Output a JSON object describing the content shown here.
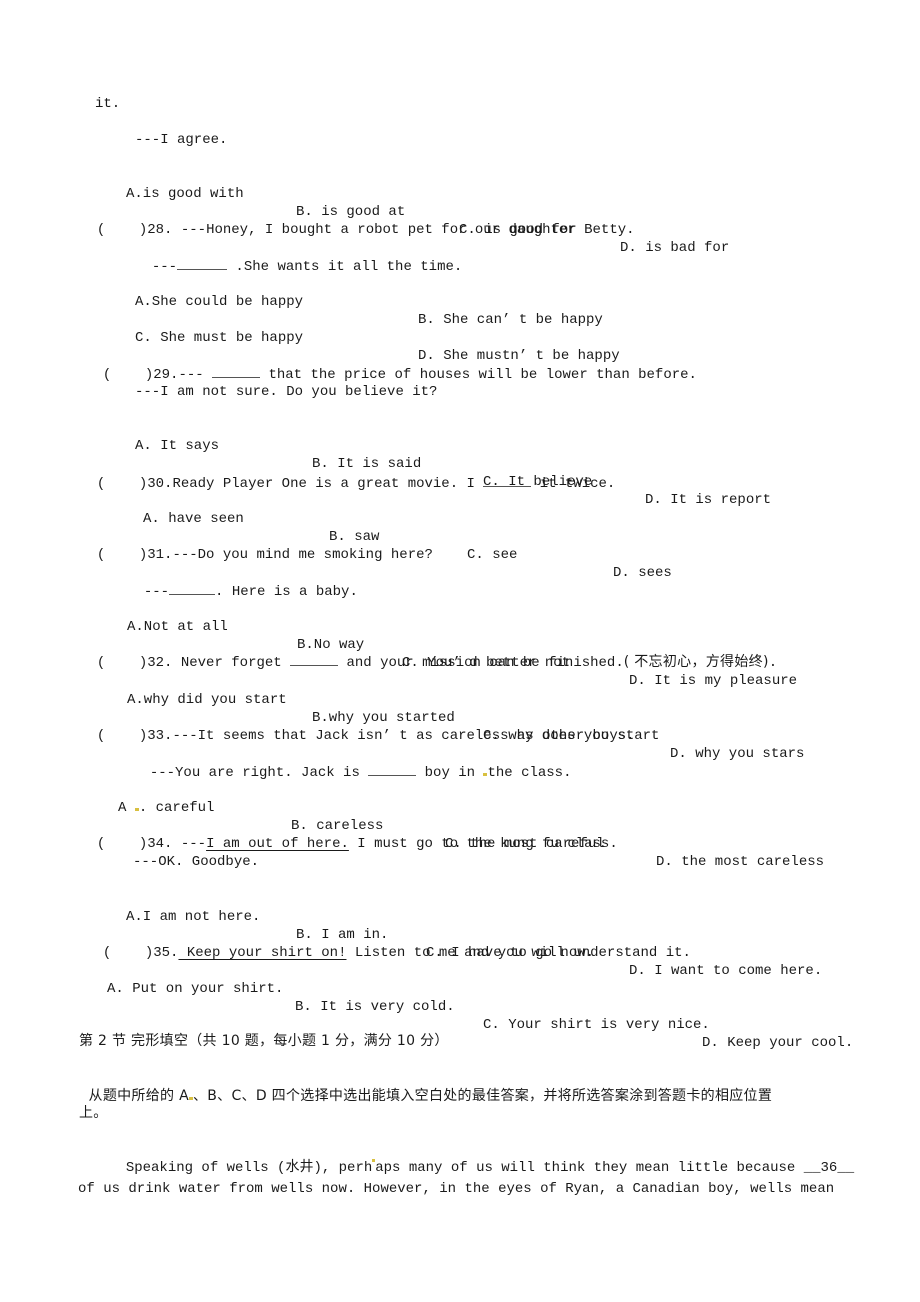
{
  "questions": {
    "q27_tail": {
      "text": "it.",
      "reply": "---I agree.",
      "options": [
        "A.is good with",
        "B. is good at",
        "C. is good for",
        "D. is bad for"
      ]
    },
    "q28": {
      "paren": "(    )",
      "number": "28.",
      "prompt": "---Honey, I bought a robot pet for our daughter Betty.",
      "reply_prefix": "---",
      "reply_suffix": " .She wants it all the time.",
      "options": [
        "A.She could be happy",
        "B. She can’ t be happy",
        "C. She must be happy",
        "D. She mustn’ t be happy"
      ]
    },
    "q29": {
      "paren": "(    )",
      "number": "29.",
      "prompt_prefix": "--- ",
      "prompt_suffix": " that the price of houses will be lower than before.",
      "reply": "---I am not sure. Do you believe it?",
      "options": [
        "A. It says",
        "B. It is said",
        "C. It believe",
        "D. It is report"
      ]
    },
    "q30": {
      "paren": "(    )",
      "number": "30.",
      "prompt_prefix": "Ready Player One is a great movie. I ",
      "prompt_suffix": " it twice.",
      "options": [
        "A. have seen",
        "B. saw",
        "C. see",
        "D. sees"
      ]
    },
    "q31": {
      "paren": "(    )",
      "number": "31.",
      "prompt": "---Do you mind me smoking here?",
      "reply_prefix": "---",
      "reply_suffix": ". Here is a baby.",
      "options": [
        "A.Not at all",
        "B.No way",
        "C. You’ d better not",
        "D. It is my pleasure"
      ]
    },
    "q32": {
      "paren": "(    )",
      "number": "32.",
      "prompt_prefix": " Never forget ",
      "prompt_suffix": " and your mission can be finished.",
      "prompt_cn": "( 不忘初心，方得始终)",
      "prompt_end": ".",
      "options": [
        "A.why did you start",
        "B.why you started",
        "C. why does you start",
        "D. why you stars"
      ]
    },
    "q33": {
      "paren": "(    )",
      "number": "33.",
      "prompt": "---It seems that Jack isn’ t as careless as other boys.",
      "reply_prefix": "---You are right. Jack is ",
      "reply_suffix_a": " boy in ",
      "reply_suffix_b": "the class.",
      "options": [
        "A ",
        ". careful",
        "B. careless",
        "C. the most careful",
        "D. the most careless"
      ]
    },
    "q34": {
      "paren": "(    )",
      "number": "34.",
      "prompt_prefix": " ---",
      "prompt_underlined": "I am out of here.",
      "prompt_suffix": " I must go to the kung fu class.",
      "reply": "---OK. Goodbye.",
      "options": [
        "A.I am not here.",
        "B. I am in.",
        "C. I have to go now.",
        "D. I want to come here."
      ]
    },
    "q35": {
      "paren": "(    )",
      "number": "35.",
      "prompt_underlined": " Keep your shirt on!",
      "prompt_suffix": " Listen to me and you will understand it.",
      "options": [
        "A. Put on your shirt.",
        "B. It is very cold.",
        "C. Your shirt is very nice.",
        "D. Keep your cool."
      ]
    }
  },
  "section2": {
    "heading": "第 2 节 完形填空（共 10 题，每小题 1 分，满分 10 分）",
    "instruction_a": "从题中所给的 A",
    "instruction_b": "、B、C、D 四个选择中选出能填入空白处的最佳答案，并将所选答案涂到答题卡的相应位置",
    "instruction_c": "上。",
    "passage_line1_a": "Speaking of wells (水井), perh",
    "passage_line1_b": "aps many of us will think they mean little because __36__",
    "passage_line2": "of us drink water from wells now. However, in the eyes of Ryan, a Canadian boy, wells mean"
  }
}
